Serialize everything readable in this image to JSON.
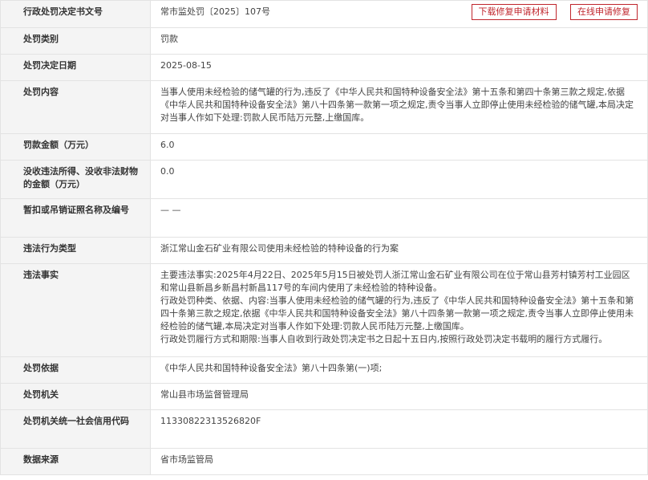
{
  "rows": [
    {
      "label": "行政处罚决定书文号",
      "value": "常市监处罚〔2025〕107号"
    },
    {
      "label": "处罚类别",
      "value": "罚款"
    },
    {
      "label": "处罚决定日期",
      "value": "2025-08-15"
    },
    {
      "label": "处罚内容",
      "value": "当事人使用未经检验的储气罐的行为,违反了《中华人民共和国特种设备安全法》第十五条和第四十条第三款之规定,依据《中华人民共和国特种设备安全法》第八十四条第一款第一项之规定,责令当事人立即停止使用未经检验的储气罐,本局决定对当事人作如下处理:罚款人民币陆万元整,上缴国库。"
    },
    {
      "label": "罚款金额（万元）",
      "value": "6.0"
    },
    {
      "label": "没收违法所得、没收非法财物的金额（万元）",
      "value": "0.0"
    },
    {
      "label": "暂扣或吊销证照名称及编号",
      "value": "— —"
    },
    {
      "label": "违法行为类型",
      "value": "浙江常山金石矿业有限公司使用未经检验的特种设备的行为案"
    },
    {
      "label": "违法事实",
      "paragraphs": [
        "主要违法事实:2025年4月22日、2025年5月15日被处罚人浙江常山金石矿业有限公司在位于常山县芳村镇芳村工业园区和常山县新昌乡新昌村新昌117号的车间内使用了未经检验的特种设备。",
        "行政处罚种类、依据、内容:当事人使用未经检验的储气罐的行为,违反了《中华人民共和国特种设备安全法》第十五条和第四十条第三款之规定,依据《中华人民共和国特种设备安全法》第八十四条第一款第一项之规定,责令当事人立即停止使用未经检验的储气罐,本局决定对当事人作如下处理:罚款人民币陆万元整,上缴国库。",
        "行政处罚履行方式和期限:当事人自收到行政处罚决定书之日起十五日内,按照行政处罚决定书载明的履行方式履行。"
      ]
    },
    {
      "label": "处罚依据",
      "value": "《中华人民共和国特种设备安全法》第八十四条第(一)项;"
    },
    {
      "label": "处罚机关",
      "value": "常山县市场监督管理局"
    },
    {
      "label": "处罚机关统一社会信用代码",
      "value": "11330822313526820F"
    },
    {
      "label": "数据来源",
      "value": "省市场监管局"
    }
  ],
  "buttons": {
    "download_repair": "下载修复申请材料",
    "online_repair": "在线申请修复"
  },
  "colors": {
    "accent": "#c0262d",
    "label_bg": "#f4f4f4",
    "border": "#e3e3e3"
  }
}
